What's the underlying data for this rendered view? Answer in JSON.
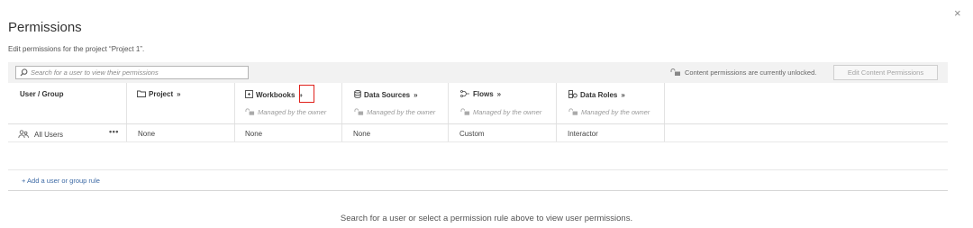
{
  "dialog": {
    "title": "Permissions",
    "subtitle": "Edit permissions for the project “Project 1”.",
    "close_glyph": "×"
  },
  "toolbar": {
    "search_placeholder": "Search for a user to view their permissions",
    "lock_status": "Content permissions are currently unlocked.",
    "edit_button": "Edit Content Permissions"
  },
  "table": {
    "user_group_header": "User / Group",
    "expand_glyph": "»",
    "managed_text": "Managed by the owner",
    "columns": [
      {
        "label": "Project",
        "icon": "folder-icon"
      },
      {
        "label": "Workbooks",
        "icon": "workbook-icon"
      },
      {
        "label": "Data Sources",
        "icon": "data-source-icon"
      },
      {
        "label": "Flows",
        "icon": "flows-icon"
      },
      {
        "label": "Data Roles",
        "icon": "data-roles-icon"
      }
    ],
    "rows": [
      {
        "name": "All Users",
        "icon": "users-group-icon",
        "more_glyph": "•••",
        "values": [
          "None",
          "None",
          "None",
          "Custom",
          "Interactor"
        ]
      }
    ],
    "add_rule": "+ Add a user or group rule"
  },
  "hint": "Search for a user or select a permission rule above to view user permissions.",
  "colors": {
    "link": "#3d6aa5",
    "highlight": "#e0211b",
    "toolbar_bg": "#f2f2f2"
  }
}
